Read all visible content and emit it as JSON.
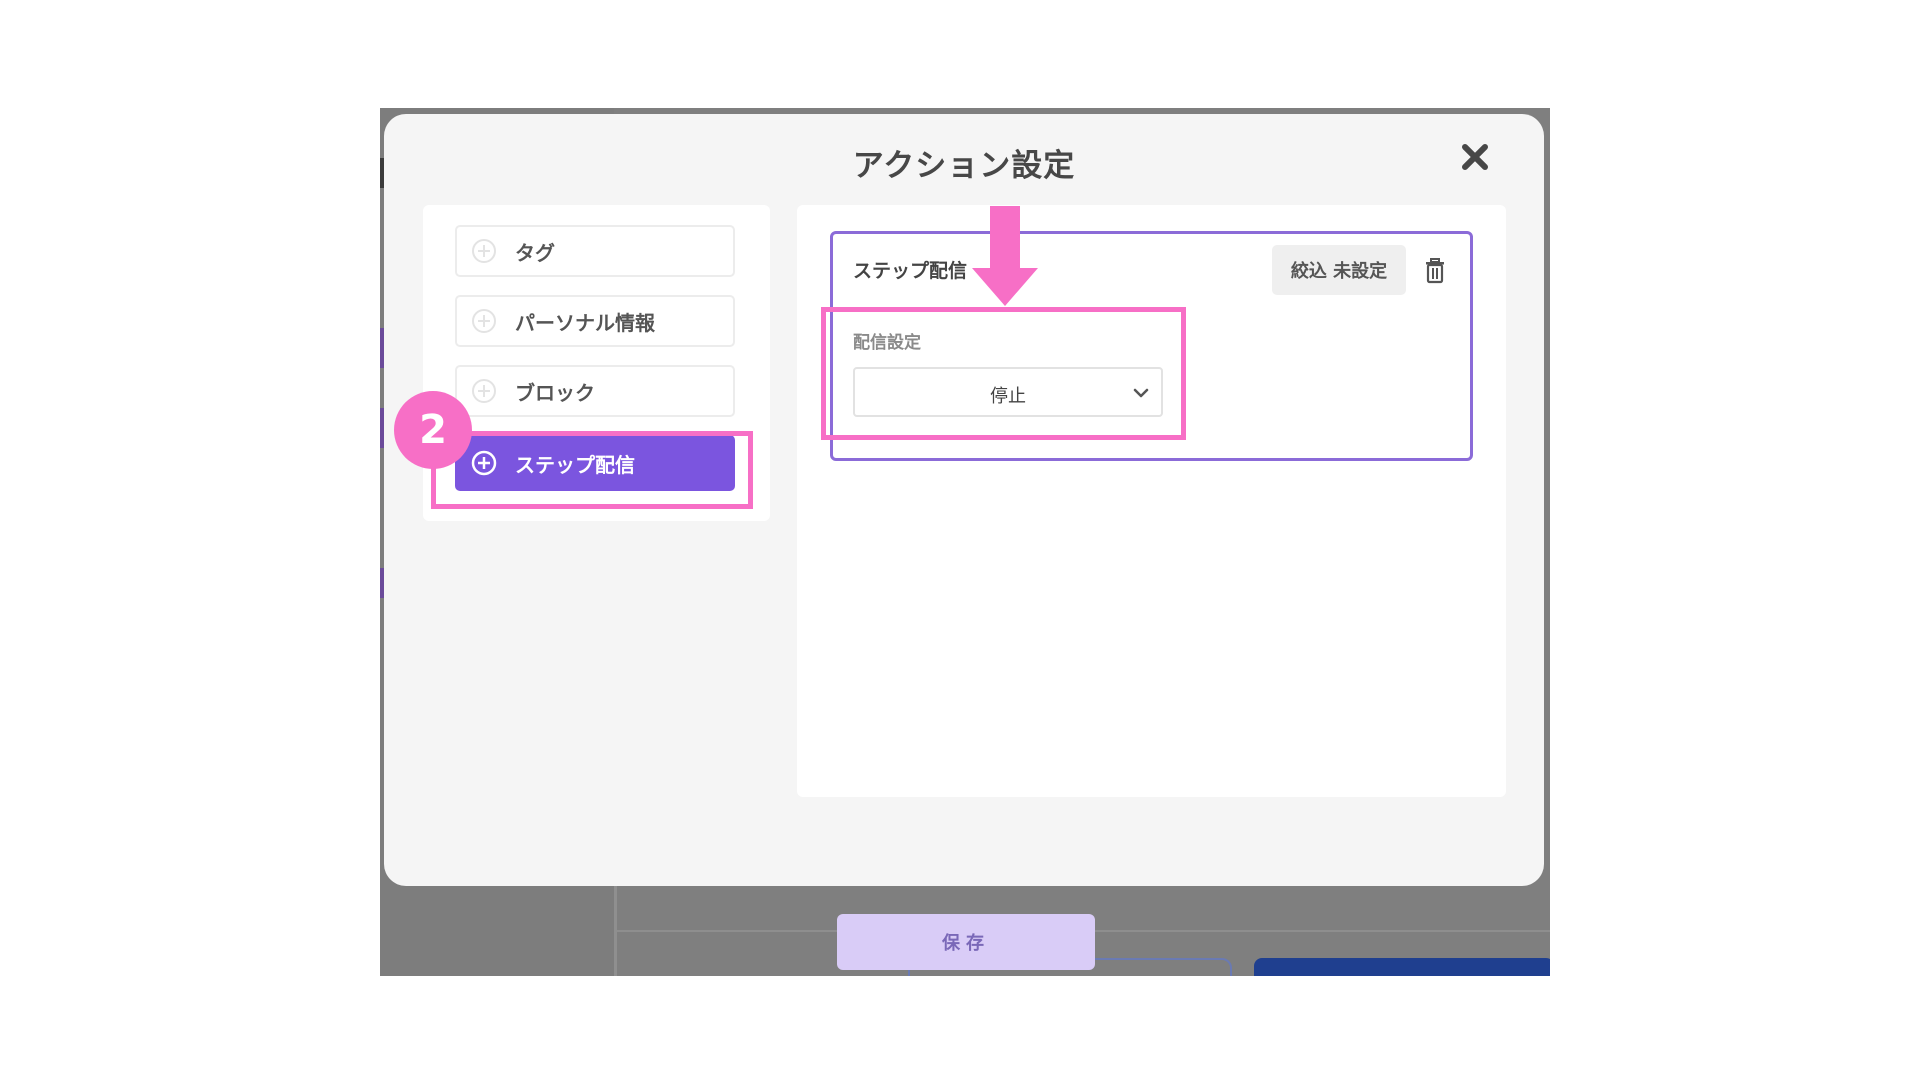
{
  "modal": {
    "title": "アクション設定"
  },
  "action_list": {
    "items": [
      {
        "label": "タグ",
        "active": false
      },
      {
        "label": "パーソナル情報",
        "active": false
      },
      {
        "label": "ブロック",
        "active": false
      },
      {
        "label": "ステップ配信",
        "active": true
      }
    ]
  },
  "step_card": {
    "title": "ステップ配信",
    "filter_label": "絞込 未設定",
    "field_label": "配信設定",
    "select_value": "停止"
  },
  "annotation": {
    "step_number": "2",
    "color": "#f76fc6"
  },
  "footer": {
    "save_label": "保存"
  },
  "colors": {
    "accent": "#7b55df",
    "card_border": "#8b6bd8",
    "save_bg": "#d9ccf7"
  },
  "icons": {
    "close": "close-icon",
    "plus": "plus-circle-icon",
    "trash": "trash-icon",
    "chevron": "chevron-down-icon"
  }
}
